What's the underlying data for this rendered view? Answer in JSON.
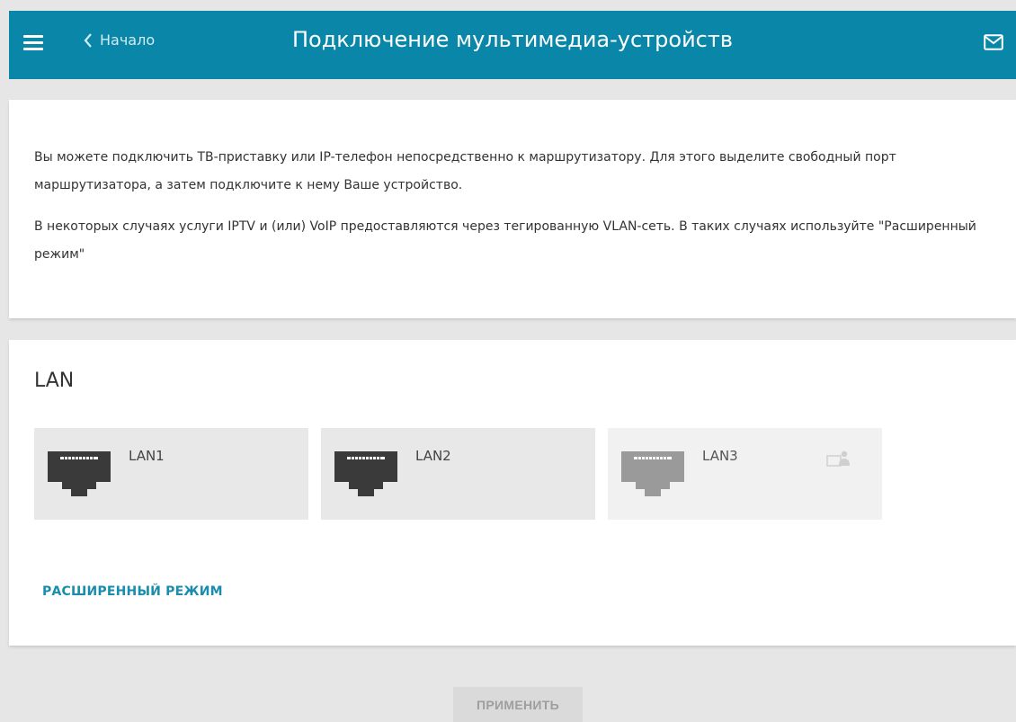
{
  "header": {
    "back_label": "Начало",
    "title": "Подключение мультимедиа-устройств"
  },
  "info": {
    "paragraph1": "Вы можете подключить ТВ-приставку или IP-телефон непосредственно к маршрутизатору. Для этого выделите свободный порт маршрутизатора, а затем подключите к нему Ваше устройство.",
    "paragraph2": "В некоторых случаях услуги IPTV и (или) VoIP предоставляются через тегированную VLAN-сеть. В таких случаях используйте \"Расширенный режим\""
  },
  "lan": {
    "title": "LAN",
    "ports": [
      {
        "label": "LAN1",
        "state": "free",
        "icon": "ethernet-port-icon"
      },
      {
        "label": "LAN2",
        "state": "free",
        "icon": "ethernet-port-icon"
      },
      {
        "label": "LAN3",
        "state": "occupied",
        "icon": "ethernet-port-icon",
        "device_icon": "device-icon"
      }
    ],
    "advanced_link": "РАСШИРЕННЫЙ РЕЖИМ"
  },
  "footer": {
    "apply_label": "ПРИМЕНИТЬ",
    "apply_enabled": false
  },
  "colors": {
    "header_bg": "#0a87a8",
    "link": "#1a8cae",
    "port_icon_active": "#3a3a3a",
    "port_icon_inactive": "#9a9a9a"
  }
}
